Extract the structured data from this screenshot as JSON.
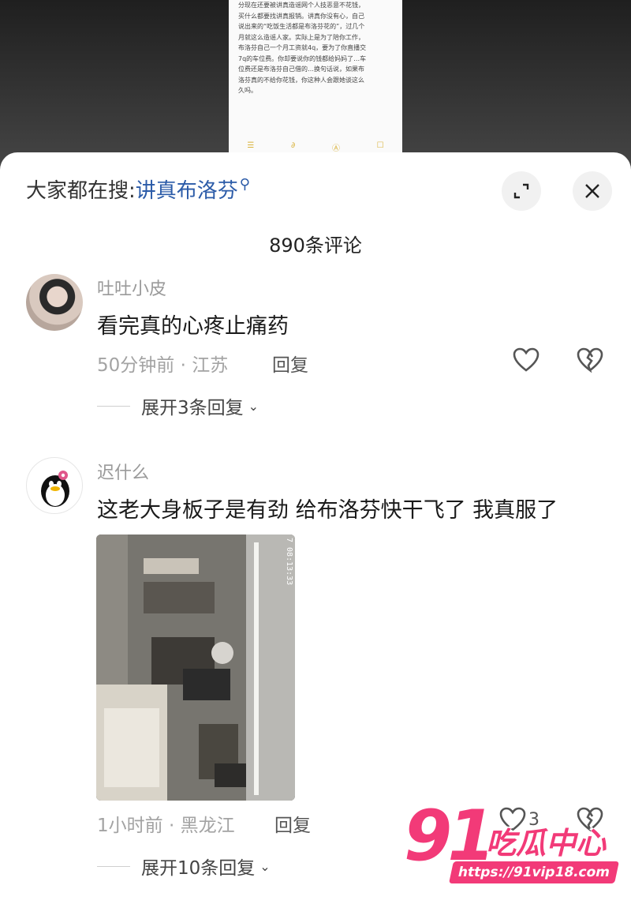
{
  "background_note": {
    "lines": [
      "分现在还要被讲真造谣网个人技恶意不花钱，",
      "买什么都要找讲真报销。讲真你没有心，自己",
      "说出来的“吃饭生活都是布洛芬花的”，过几个",
      "月就这么造谣人家。实际上是为了陪你工作，",
      "布洛芬自己一个月工资就4q，要为了你直播交",
      "7q的车位费。你却要说你的钱都给妈妈了…车",
      "位费还是布洛芬自己借的…换句话说，如果布",
      "洛芬真的不给你花钱，你这种人会跟她谈这么",
      "久吗。"
    ],
    "toolbar_icons": [
      "checklist-icon",
      "attachment-icon",
      "pen-icon",
      "edit-icon"
    ]
  },
  "header": {
    "search_prefix": "大家都在搜:",
    "search_term": "讲真布洛芬",
    "comment_count": "890条评论"
  },
  "comments": [
    {
      "username": "吐吐小皮",
      "text": "看完真的心疼止痛药",
      "time_location": "50分钟前 · 江苏",
      "reply_label": "回复",
      "expand_label": "展开3条回复"
    },
    {
      "username": "迟什么",
      "text": "这老大身板子是有劲 给布洛芬快干飞了 我真服了",
      "photo_timestamp": "7 08:13:33",
      "time_location": "1小时前 · 黑龙江",
      "reply_label": "回复",
      "like_count": "3",
      "expand_label": "展开10条回复"
    }
  ],
  "watermark": {
    "number": "91",
    "name": "吃瓜中心",
    "url": "https://91vip18.com"
  },
  "colors": {
    "accent_link": "#2b5ba8",
    "watermark_pink": "#f23a78"
  }
}
